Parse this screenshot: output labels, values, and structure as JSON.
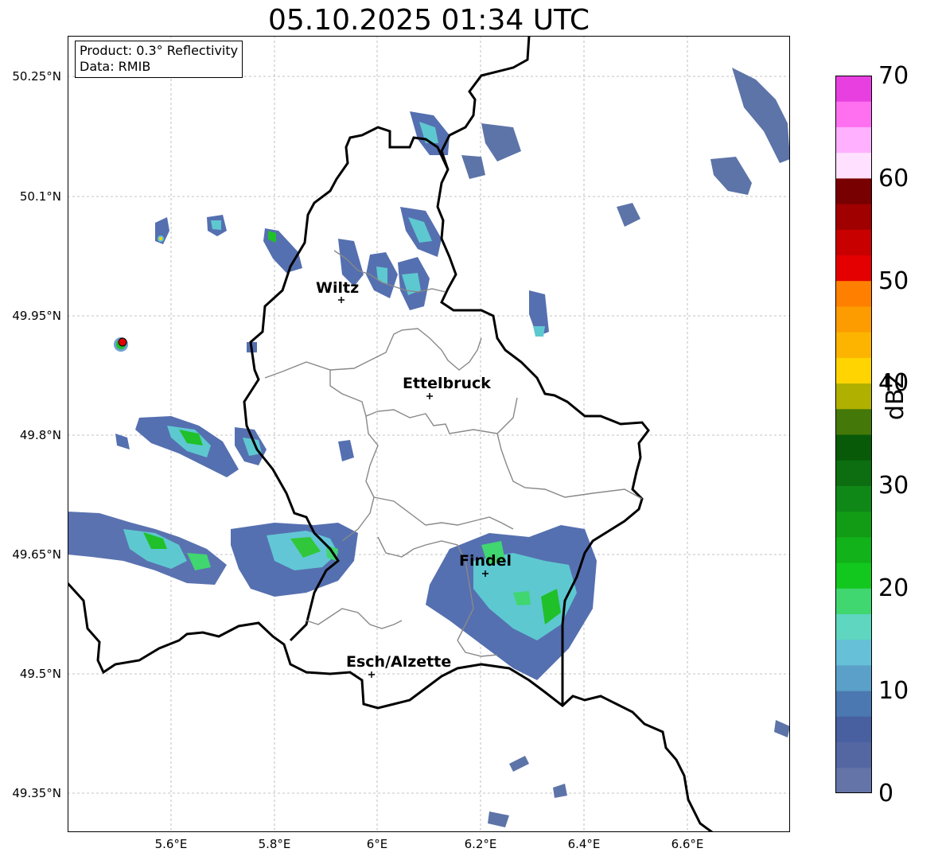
{
  "title": "05.10.2025 01:34 UTC",
  "info_box": {
    "product": "Product: 0.3° Reflectivity",
    "data_source": "Data: RMIB"
  },
  "axes": {
    "lat_ticks": [
      "50.25°N",
      "50.1°N",
      "49.95°N",
      "49.8°N",
      "49.65°N",
      "49.5°N",
      "49.35°N"
    ],
    "lon_ticks": [
      "5.6°E",
      "5.8°E",
      "6°E",
      "6.2°E",
      "6.4°E",
      "6.6°E"
    ]
  },
  "cities": [
    {
      "name": "Wiltz"
    },
    {
      "name": "Ettelbruck"
    },
    {
      "name": "Findel"
    },
    {
      "name": "Esch/Alzette"
    }
  ],
  "colorbar": {
    "label": "dBZ",
    "ticks": [
      "70",
      "60",
      "50",
      "40",
      "30",
      "20",
      "10",
      "0"
    ],
    "colors": [
      "#6474a8",
      "#5567a3",
      "#4860a0",
      "#4b78b0",
      "#5aa0c8",
      "#66c0d8",
      "#5ed6c0",
      "#40d670",
      "#12c81e",
      "#12b21a",
      "#129c16",
      "#108818",
      "#0c6e10",
      "#085a08",
      "#447808",
      "#b0b000",
      "#ffd400",
      "#fcb400",
      "#fc9c00",
      "#ff8000",
      "#e40000",
      "#c80000",
      "#a00000",
      "#780000",
      "#ffe0ff",
      "#ffb0ff",
      "#ff70f0",
      "#e840e0"
    ]
  },
  "colors": {
    "border": "#000000",
    "canton_border": "#888888",
    "grid": "#b0b0b0"
  }
}
